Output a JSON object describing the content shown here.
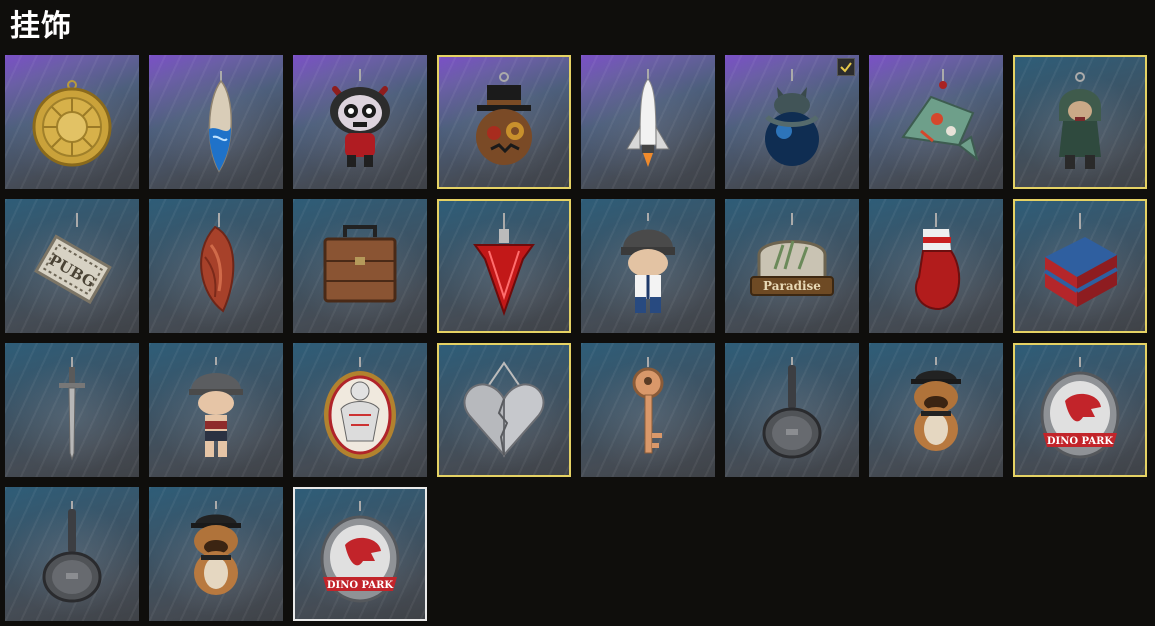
{
  "page": {
    "title": "挂饰"
  },
  "items": [
    {
      "id": "sun-medallion",
      "frame": "none",
      "bg": "rare"
    },
    {
      "id": "surfboard",
      "frame": "none",
      "bg": "rare"
    },
    {
      "id": "demon-doll",
      "frame": "none",
      "bg": "rare"
    },
    {
      "id": "steampunk-pumpkin",
      "frame": "gold",
      "bg": "rare"
    },
    {
      "id": "space-shuttle",
      "frame": "none",
      "bg": "rare"
    },
    {
      "id": "dragon-orb",
      "frame": "none",
      "bg": "rare",
      "equipped": true
    },
    {
      "id": "koi-fish",
      "frame": "none",
      "bg": "rare"
    },
    {
      "id": "hooded-figure",
      "frame": "gold",
      "bg": "standard"
    },
    {
      "id": "pubg-tag",
      "frame": "none",
      "bg": "standard",
      "text": "PUBG"
    },
    {
      "id": "meat-chunk",
      "frame": "none",
      "bg": "standard"
    },
    {
      "id": "suitcase",
      "frame": "none",
      "bg": "standard"
    },
    {
      "id": "red-arrowhead",
      "frame": "gold",
      "bg": "standard"
    },
    {
      "id": "helmet-soldier",
      "frame": "none",
      "bg": "standard"
    },
    {
      "id": "paradise-sign",
      "frame": "none",
      "bg": "standard",
      "text": "Paradise"
    },
    {
      "id": "boxing-glove",
      "frame": "none",
      "bg": "standard"
    },
    {
      "id": "supply-crate",
      "frame": "gold",
      "bg": "standard"
    },
    {
      "id": "sword",
      "frame": "none",
      "bg": "standard"
    },
    {
      "id": "helmet-girl",
      "frame": "none",
      "bg": "standard"
    },
    {
      "id": "muscle-badge",
      "frame": "none",
      "bg": "standard"
    },
    {
      "id": "broken-heart",
      "frame": "gold",
      "bg": "standard"
    },
    {
      "id": "key",
      "frame": "none",
      "bg": "standard"
    },
    {
      "id": "frying-pan",
      "frame": "none",
      "bg": "standard"
    },
    {
      "id": "bulldog-cap",
      "frame": "none",
      "bg": "standard"
    },
    {
      "id": "dino-park-badge",
      "frame": "gold",
      "bg": "standard",
      "text": "DINO PARK"
    },
    {
      "id": "frying-pan-2",
      "frame": "none",
      "bg": "standard"
    },
    {
      "id": "bulldog-cap-2",
      "frame": "none",
      "bg": "standard"
    },
    {
      "id": "dino-park-badge-2",
      "frame": "selected",
      "bg": "standard",
      "text": "DINO PARK"
    }
  ]
}
